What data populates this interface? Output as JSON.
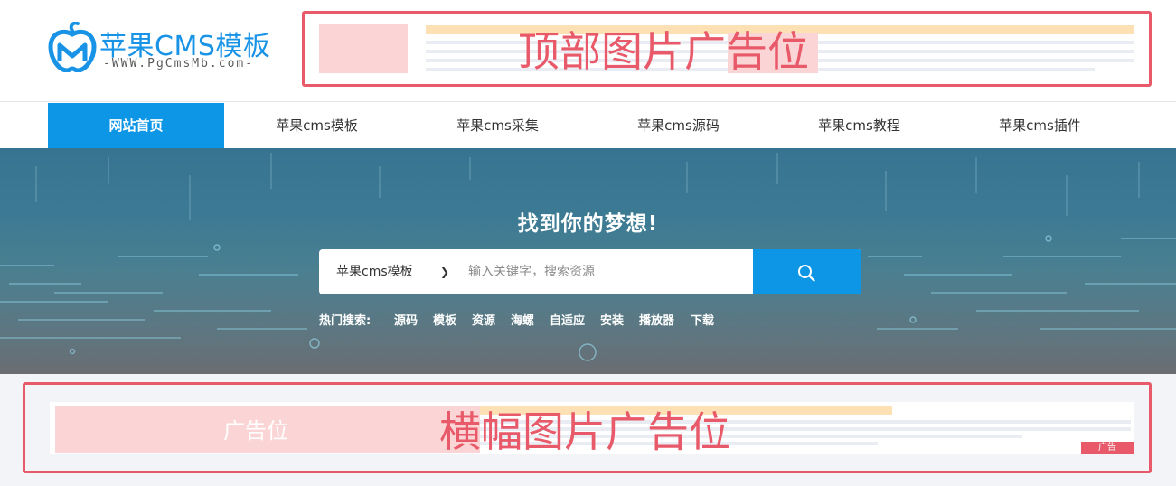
{
  "brand": {
    "name": "苹果CMS模板",
    "url": "-WWW.PgCmsMb.com-",
    "color": "#1893e6"
  },
  "top_ad": {
    "label": "顶部图片广告位",
    "border_color": "#e85a6a"
  },
  "nav": {
    "accent": "#0e96e6",
    "items": [
      {
        "label": "网站首页",
        "active": true
      },
      {
        "label": "苹果cms模板",
        "active": false
      },
      {
        "label": "苹果cms采集",
        "active": false
      },
      {
        "label": "苹果cms源码",
        "active": false
      },
      {
        "label": "苹果cms教程",
        "active": false
      },
      {
        "label": "苹果cms插件",
        "active": false
      }
    ]
  },
  "hero": {
    "slogan": "找到你的梦想!",
    "search": {
      "category": "苹果cms模板",
      "placeholder": "输入关键字，搜索资源",
      "button_icon": "search-icon"
    },
    "hot": {
      "label": "热门搜索:",
      "keywords": [
        "源码",
        "模板",
        "资源",
        "海螺",
        "自适应",
        "安装",
        "播放器",
        "下载"
      ]
    }
  },
  "banner_ad": {
    "label": "横幅图片广告位",
    "placeholder_text": "广告位",
    "tag": "广告"
  }
}
